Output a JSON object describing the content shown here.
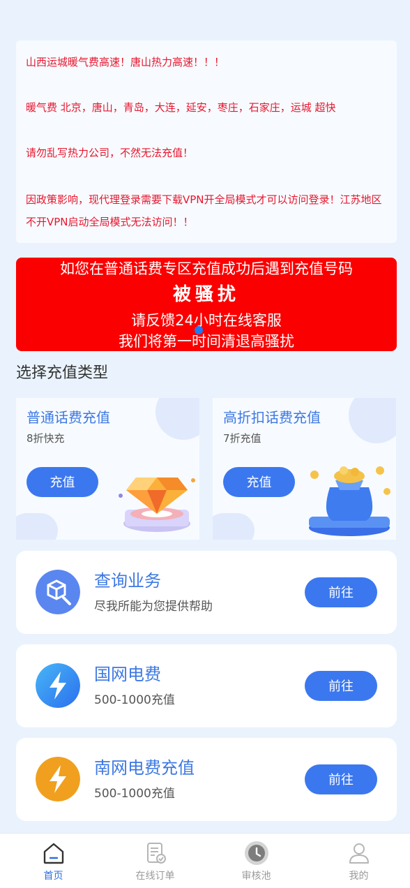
{
  "notice": {
    "lines": [
      "山西运城暖气费高速！唐山热力高速！！！",
      "暖气费 北京，唐山，青岛，大连，延安，枣庄，石家庄，运城 超快",
      "请勿乱写热力公司，不然无法充值！",
      "因政策影响，现代理登录需要下载VPN开全局模式才可以访问登录！江苏地区不开VPN启动全局模式无法访问！！"
    ],
    "color": "#e8162e"
  },
  "banner": {
    "line1": "如您在普通话费专区充值成功后遇到充值号码",
    "line2": "被骚扰",
    "line3": "请反馈24小时在线客服",
    "line4": "我们将第一时间清退高骚扰",
    "color": "#fb0000"
  },
  "section_title": "选择充值类型",
  "recharge_cards": [
    {
      "title": "普通话费充值",
      "subtitle": "8折快充",
      "button": "充值",
      "icon": "diamond-icon"
    },
    {
      "title": "高折扣话费充值",
      "subtitle": "7折充值",
      "button": "充值",
      "icon": "money-bag-icon"
    }
  ],
  "services": [
    {
      "name": "查询业务",
      "desc": "尽我所能为您提供帮助",
      "button": "前往",
      "icon": "search-cube-icon",
      "icon_color": "#5a86f0"
    },
    {
      "name": "国网电费",
      "desc": "500-1000充值",
      "button": "前往",
      "icon": "lightning-icon",
      "icon_color": "#2f7ff0"
    },
    {
      "name": "南网电费充值",
      "desc": "500-1000充值",
      "button": "前往",
      "icon": "lightning-icon",
      "icon_color": "#f0a01e"
    }
  ],
  "tabbar": [
    {
      "label": "首页",
      "icon": "home-icon",
      "active": true
    },
    {
      "label": "在线订单",
      "icon": "order-icon",
      "active": false
    },
    {
      "label": "审核池",
      "icon": "clock-icon",
      "active": false
    },
    {
      "label": "我的",
      "icon": "user-icon",
      "active": false
    }
  ],
  "accent": "#3b78ef"
}
